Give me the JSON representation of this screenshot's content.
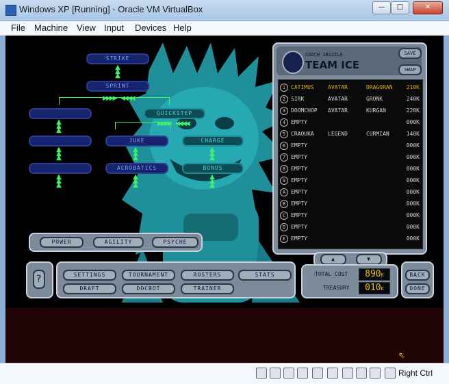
{
  "window": {
    "title": "Windows XP [Running] - Oracle VM VirtualBox",
    "controls": [
      "minimize",
      "maximize",
      "close"
    ]
  },
  "menubar": {
    "items": [
      "File",
      "Machine",
      "View",
      "Input",
      "Devices",
      "Help"
    ]
  },
  "skill_tree": {
    "nodes": [
      {
        "id": "n1",
        "label": "STRIKE",
        "style": "blue"
      },
      {
        "id": "n2",
        "label": "SPRINT",
        "style": "blue"
      },
      {
        "id": "n3",
        "label": "",
        "style": "blue"
      },
      {
        "id": "n4",
        "label": "QUICKSTEP",
        "style": "teal"
      },
      {
        "id": "n5",
        "label": "",
        "style": "blue"
      },
      {
        "id": "n6",
        "label": "JUKE",
        "style": "blue"
      },
      {
        "id": "n7",
        "label": "CHARGE",
        "style": "teal"
      },
      {
        "id": "n8",
        "label": "",
        "style": "blue"
      },
      {
        "id": "n9",
        "label": "ACROBATICS",
        "style": "blue"
      },
      {
        "id": "n10",
        "label": "BONUS",
        "style": "teal"
      }
    ]
  },
  "team_panel": {
    "coach": "COACH JBIZZLE",
    "team_name": "TEAM ICE",
    "save_label": "SAVE",
    "swap_label": "SWAP",
    "roster": [
      {
        "num": "1",
        "name": "CATIMUS",
        "type": "AVATAR",
        "species": "DRAGORAN",
        "cost": "210K"
      },
      {
        "num": "2",
        "name": "SIRK",
        "type": "AVATAR",
        "species": "GRONK",
        "cost": "240K"
      },
      {
        "num": "3",
        "name": "DOOMCHOP",
        "type": "AVATAR",
        "species": "KURGAN",
        "cost": "220K"
      },
      {
        "num": "4",
        "name": "EMPTY",
        "type": "",
        "species": "",
        "cost": "000K"
      },
      {
        "num": "5",
        "name": "CRAOUKA",
        "type": "LEGEND",
        "species": "CURMIAN",
        "cost": "140K"
      },
      {
        "num": "6",
        "name": "EMPTY",
        "type": "",
        "species": "",
        "cost": "000K"
      },
      {
        "num": "7",
        "name": "EMPTY",
        "type": "",
        "species": "",
        "cost": "000K"
      },
      {
        "num": "8",
        "name": "EMPTY",
        "type": "",
        "species": "",
        "cost": "000K"
      },
      {
        "num": "9",
        "name": "EMPTY",
        "type": "",
        "species": "",
        "cost": "000K"
      },
      {
        "num": "A",
        "name": "EMPTY",
        "type": "",
        "species": "",
        "cost": "000K"
      },
      {
        "num": "B",
        "name": "EMPTY",
        "type": "",
        "species": "",
        "cost": "000K"
      },
      {
        "num": "C",
        "name": "EMPTY",
        "type": "",
        "species": "",
        "cost": "000K"
      },
      {
        "num": "D",
        "name": "EMPTY",
        "type": "",
        "species": "",
        "cost": "000K"
      },
      {
        "num": "E",
        "name": "EMPTY",
        "type": "",
        "species": "",
        "cost": "000K"
      }
    ]
  },
  "controls": {
    "stat_tabs": [
      "POWER",
      "AGILITY",
      "PSYCHE"
    ],
    "help_label": "?",
    "buttons_row1": [
      "SETTINGS",
      "TOURNAMENT",
      "ROSTERS",
      "STATS"
    ],
    "buttons_row2": [
      "DRAFT",
      "DOCBOT",
      "TRAINER"
    ],
    "total_cost_label": "TOTAL COST",
    "total_cost_value": "890",
    "total_cost_unit": "K",
    "treasury_label": "TREASURY",
    "treasury_value": "010",
    "treasury_unit": "K",
    "back_label": "BACK",
    "done_label": "DONE"
  },
  "statusbar": {
    "host_key": "Right Ctrl"
  },
  "colors": {
    "accent_teal": "#2fb9c4",
    "arrow_green": "#3ef06a",
    "lcd_yellow": "#e8c316",
    "panel_gray": "#7d8a9a"
  }
}
